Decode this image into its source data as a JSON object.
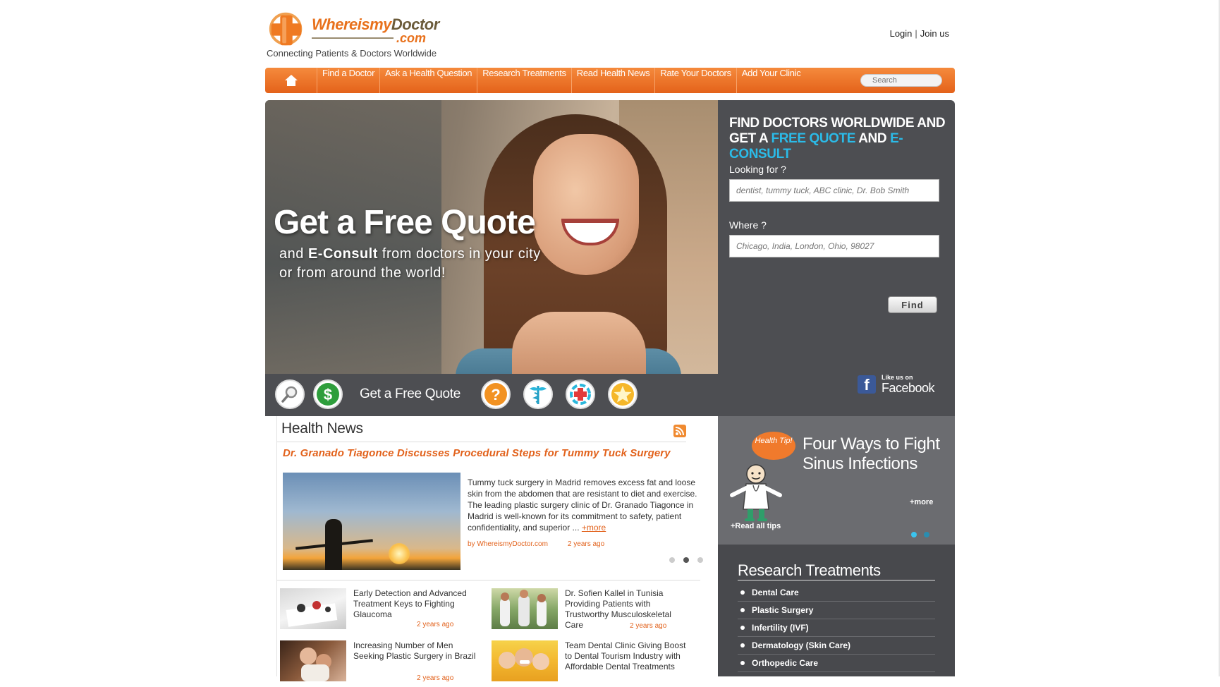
{
  "header": {
    "logo": {
      "name_a": "Whereismy",
      "name_b": "Doctor",
      "suffix": ".com",
      "tagline": "Connecting Patients & Doctors Worldwide"
    },
    "login": "Login",
    "separator": "|",
    "join": "Join us"
  },
  "menu": {
    "home_icon": "home-icon",
    "items": [
      "Find a Doctor",
      "Ask a Health Question",
      "Research Treatments",
      "Read Health News",
      "Rate Your Doctors",
      "Add Your Clinic"
    ],
    "search_placeholder": "Search"
  },
  "hero": {
    "title": "Get a Free Quote",
    "sub_a": "and ",
    "sub_b": "E-Consult",
    "sub_c": " from doctors in your city or from around the world!"
  },
  "panel": {
    "head_line1": "FIND DOCTORS WORLDWIDE AND",
    "head_get": "GET A ",
    "head_free": "FREE QUOTE",
    "head_and": " AND ",
    "head_econsult": "E-CONSULT",
    "looking_label": "Looking for ?",
    "looking_placeholder": "dentist, tummy tuck, ABC clinic, Dr. Bob Smith",
    "where_label": "Where ?",
    "where_placeholder": "Chicago, India, London, Ohio, 98027",
    "find_button": "Find",
    "facebook_small": "Like us on",
    "facebook_big": "Facebook",
    "accent_color": "#2bbbe8"
  },
  "strip": {
    "label": "Get a Free Quote",
    "icons": [
      "magnifier-icon",
      "dollar-icon",
      "question-icon",
      "caduceus-icon",
      "medical-cross-icon",
      "star-icon"
    ]
  },
  "news": {
    "title": "Health News",
    "headline": "Dr. Granado Tiagonce Discusses Procedural Steps for Tummy Tuck Surgery",
    "body": "Tummy tuck surgery in Madrid removes excess fat and loose skin from the abdomen that are resistant to diet and exercise. The leading plastic surgery clinic of Dr. Granado Tiagonce in Madrid is well-known for its commitment to safety, patient confidentiality, and superior ... ",
    "more": "+more",
    "by": "by WhereismyDoctor.com",
    "ago": "2 years ago",
    "items": [
      {
        "title": "Early Detection and Advanced Treatment Keys to Fighting Glaucoma",
        "ago": "2 years ago"
      },
      {
        "title": "Dr. Sofien Kallel in Tunisia Providing Patients with Trustworthy Musculoskeletal Care",
        "ago": "2 years ago"
      },
      {
        "title": "Increasing Number of Men Seeking Plastic Surgery in Brazil",
        "ago": "2 years ago"
      },
      {
        "title": "Team Dental Clinic Giving Boost to Dental Tourism Industry with Affordable Dental Treatments",
        "ago": ""
      }
    ],
    "brand_color": "#e2621c"
  },
  "tip": {
    "badge": "Health Tip!",
    "title": "Four Ways to Fight Sinus Infections",
    "more": "+more",
    "read_all": "+Read all tips"
  },
  "research": {
    "title": "Research Treatments",
    "items": [
      "Dental Care",
      "Plastic Surgery",
      "Infertility (IVF)",
      "Dermatology (Skin Care)",
      "Orthopedic Care"
    ]
  }
}
